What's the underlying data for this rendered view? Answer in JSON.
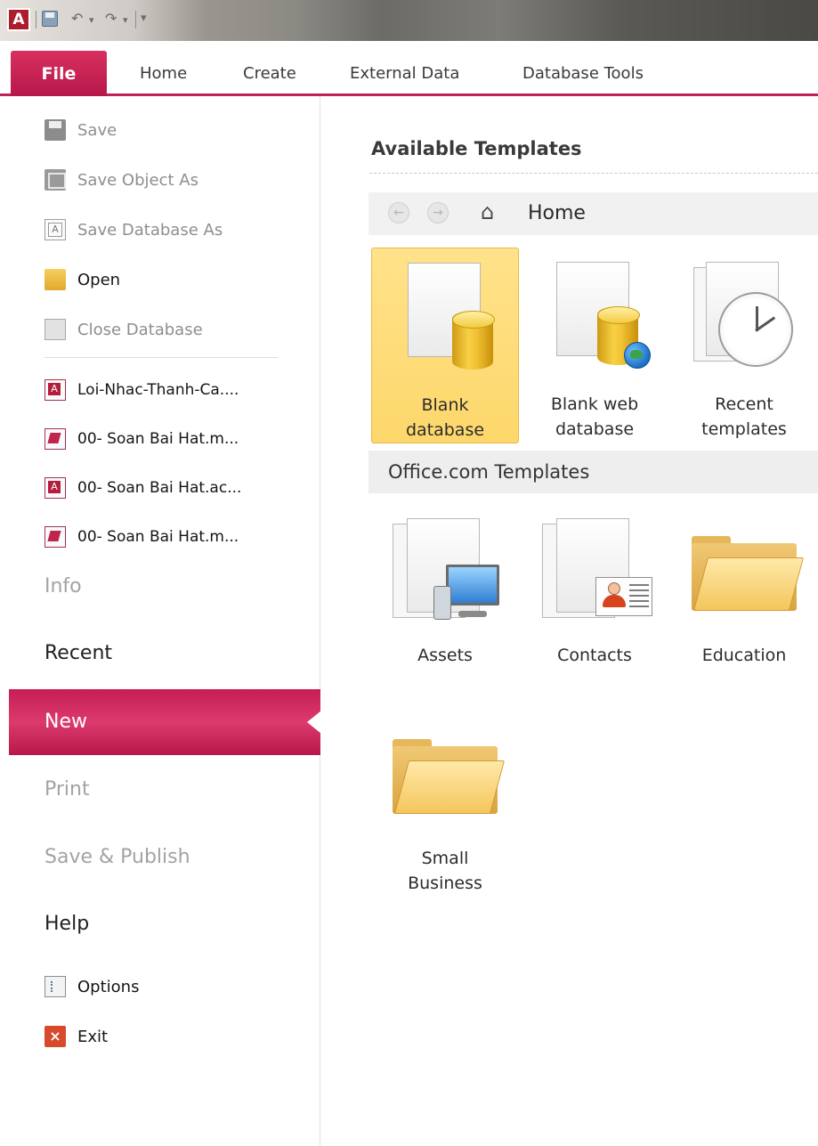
{
  "app": {
    "logo_letter": "A"
  },
  "ribbon_tabs": [
    "File",
    "Home",
    "Create",
    "External Data",
    "Database Tools"
  ],
  "backstage": {
    "commands": [
      {
        "label": "Save",
        "icon": "save-icon",
        "enabled": false
      },
      {
        "label": "Save Object As",
        "icon": "save-object-icon",
        "enabled": false
      },
      {
        "label": "Save Database As",
        "icon": "save-database-icon",
        "enabled": false
      },
      {
        "label": "Open",
        "icon": "open-folder-icon",
        "enabled": true
      },
      {
        "label": "Close Database",
        "icon": "close-database-icon",
        "enabled": false
      }
    ],
    "recent_files": [
      {
        "label": "Loi-Nhac-Thanh-Ca....",
        "icon": "access-file-icon"
      },
      {
        "label": "00- Soan Bai Hat.m...",
        "icon": "access-form-file-icon"
      },
      {
        "label": "00- Soan Bai Hat.ac...",
        "icon": "access-file-icon"
      },
      {
        "label": "00- Soan Bai Hat.m...",
        "icon": "access-form-file-icon"
      }
    ],
    "sections": {
      "info": "Info",
      "recent": "Recent",
      "new": "New",
      "print": "Print",
      "save_publish": "Save & Publish",
      "help": "Help"
    },
    "bottom_commands": [
      {
        "label": "Options",
        "icon": "options-icon"
      },
      {
        "label": "Exit",
        "icon": "exit-icon"
      }
    ]
  },
  "main": {
    "title": "Available Templates",
    "nav_location": "Home",
    "templates": [
      {
        "line1": "Blank",
        "line2": "database",
        "selected": true
      },
      {
        "line1": "Blank web",
        "line2": "database",
        "selected": false
      },
      {
        "line1": "Recent",
        "line2": "templates",
        "selected": false
      }
    ],
    "office_section": "Office.com Templates",
    "office_templates": [
      "Assets",
      "Contacts",
      "Education"
    ],
    "small_business": {
      "line1": "Small",
      "line2": "Business"
    }
  },
  "colors": {
    "accent": "#c51e54",
    "selected_tile": "#fdd76b"
  }
}
